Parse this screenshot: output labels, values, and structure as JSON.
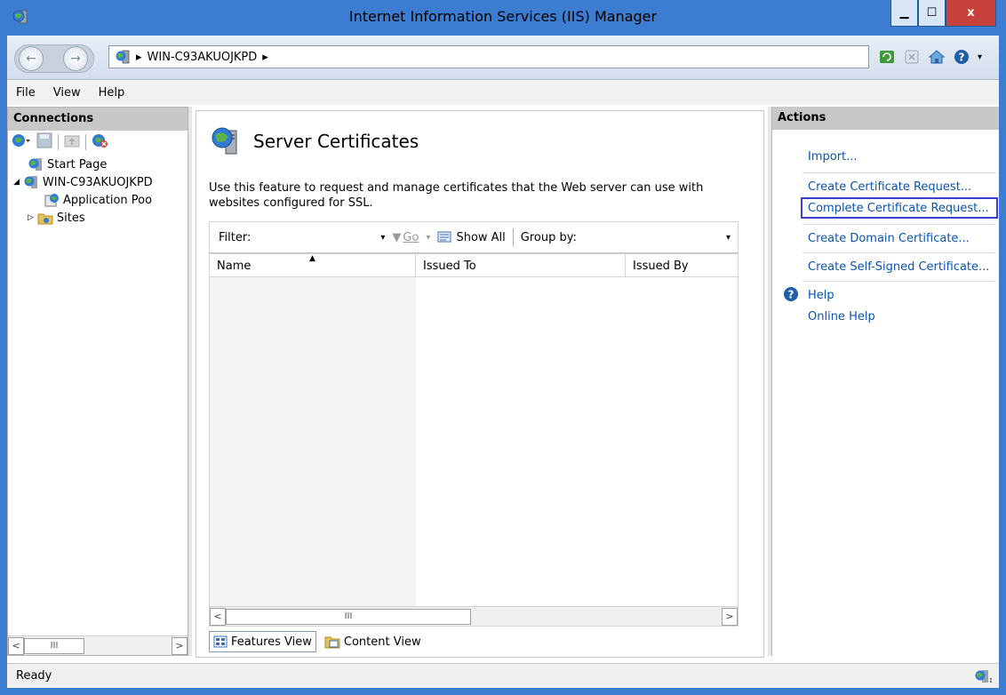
{
  "window": {
    "title": "Internet Information Services (IIS) Manager",
    "minimize": "▁",
    "maximize": "☐",
    "close": "x"
  },
  "address": {
    "separator": "▸",
    "server": "WIN-C93AKUOJKPD",
    "trailing": "▸"
  },
  "menu": {
    "file": "File",
    "view": "View",
    "help": "Help"
  },
  "connections": {
    "title": "Connections",
    "tree": [
      {
        "label": "Start Page"
      },
      {
        "label": "WIN-C93AKUOJKPD"
      },
      {
        "label": "Application Poo"
      },
      {
        "label": "Sites"
      }
    ]
  },
  "main": {
    "title": "Server Certificates",
    "description": "Use this feature to request and manage certificates that the Web server can use with websites configured for SSL.",
    "filter": {
      "label": "Filter:",
      "go": "Go",
      "show_all": "Show All",
      "group_by": "Group by:"
    },
    "columns": [
      "Name",
      "Issued To",
      "Issued By"
    ],
    "view_tabs": {
      "features": "Features View",
      "content": "Content View"
    },
    "hscroll_thumb": "III"
  },
  "actions": {
    "title": "Actions",
    "items": [
      "Import...",
      "Create Certificate Request...",
      "Complete Certificate Request...",
      "Create Domain Certificate...",
      "Create Self-Signed Certificate..."
    ],
    "help": "Help",
    "online_help": "Online Help"
  },
  "status": {
    "text": "Ready"
  },
  "colors": {
    "titlebar": "#3d7dd1",
    "link": "#0a55ad",
    "highlight_border": "#3a3fd1",
    "close_button": "#c7423a"
  }
}
